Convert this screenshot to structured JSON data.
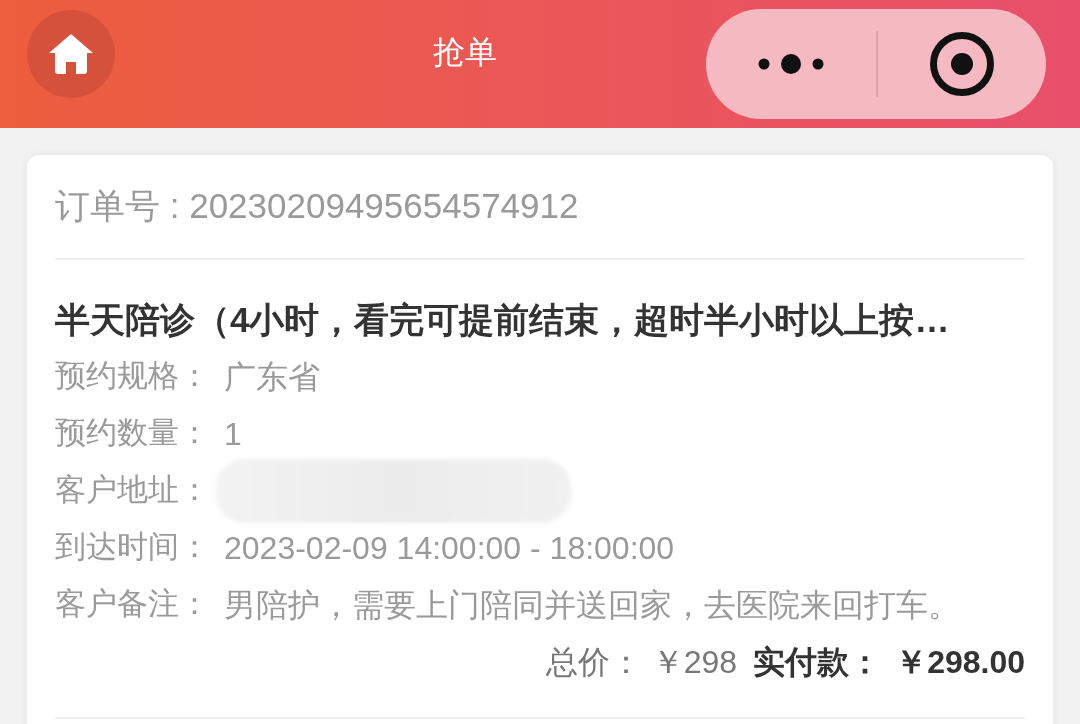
{
  "nav_bar": {
    "title": "抢单"
  },
  "order": {
    "order_number": "订单号 : 20230209495654574912",
    "title": "半天陪诊（4小时，看完可提前结束，超时半小时以上按…",
    "fields": [
      {
        "label": "预约规格：",
        "kind": "text",
        "value": "广东省"
      },
      {
        "label": "预约数量：",
        "kind": "text",
        "value": "1"
      },
      {
        "label": "客户地址：",
        "kind": "redacted"
      },
      {
        "label": "到达时间：",
        "kind": "text",
        "value": "2023-02-09 14:00:00 - 18:00:00"
      },
      {
        "label": "客户备注：",
        "kind": "text",
        "value": "男陪护，需要上门陪同并送回家，去医院来回打车。"
      }
    ],
    "totals": {
      "total_label": "总价：",
      "total": "￥298",
      "paid_label": "实付款：",
      "paid": "￥298.00"
    }
  }
}
